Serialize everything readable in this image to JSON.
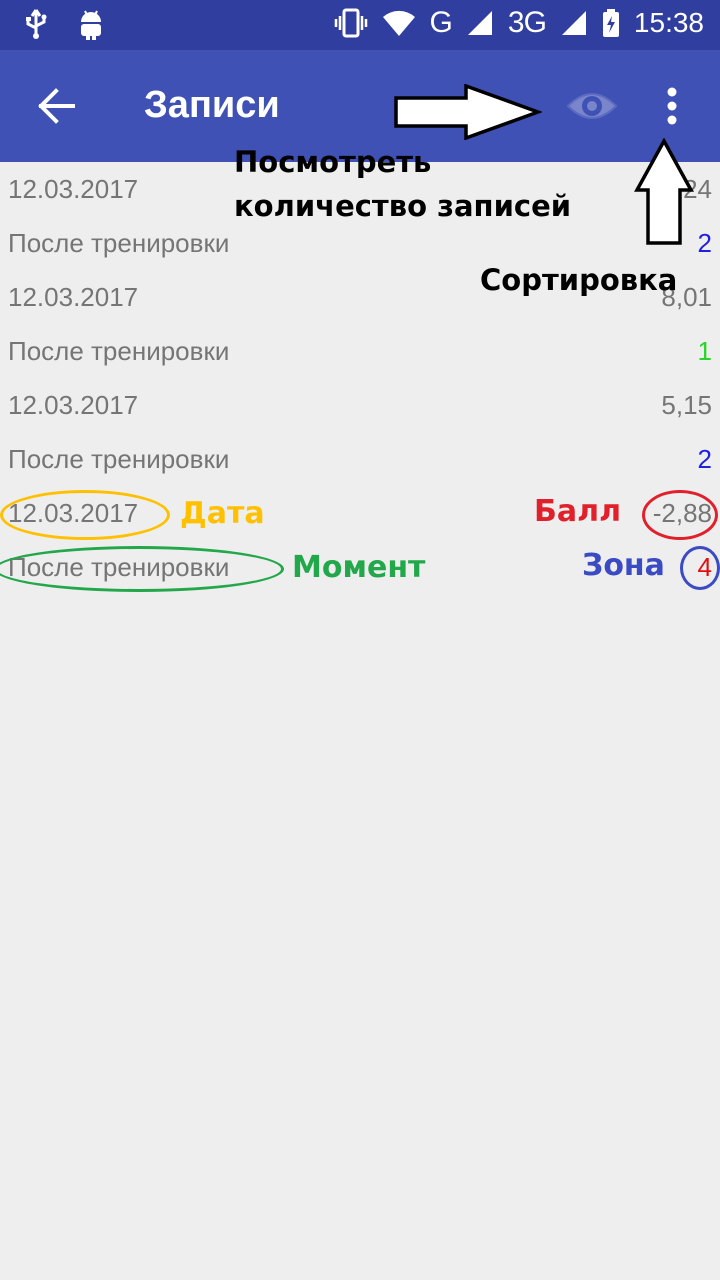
{
  "status_bar": {
    "network": "G",
    "network2": "3G",
    "time": "15:38"
  },
  "app_bar": {
    "title": "Записи"
  },
  "records": [
    {
      "date": "12.03.2017",
      "score": "7,24",
      "moment": "После тренировки",
      "zone": "2",
      "zone_color": "#2020e0"
    },
    {
      "date": "12.03.2017",
      "score": "8,01",
      "moment": "После тренировки",
      "zone": "1",
      "zone_color": "#2ad42a"
    },
    {
      "date": "12.03.2017",
      "score": "5,15",
      "moment": "После тренировки",
      "zone": "2",
      "zone_color": "#2020e0"
    },
    {
      "date": "12.03.2017",
      "score": "-2,88",
      "moment": "После тренировки",
      "zone": "4",
      "zone_color": "#e01010"
    }
  ],
  "annotations": {
    "view_count_line1": "Посмотреть",
    "view_count_line2": "количество записей",
    "sorting": "Сортировка",
    "date": "Дата",
    "score": "Балл",
    "moment": "Момент",
    "zone": "Зона"
  },
  "colors": {
    "status_bar": "#303f9f",
    "app_bar": "#3f51b5",
    "background": "#eeeeee"
  }
}
